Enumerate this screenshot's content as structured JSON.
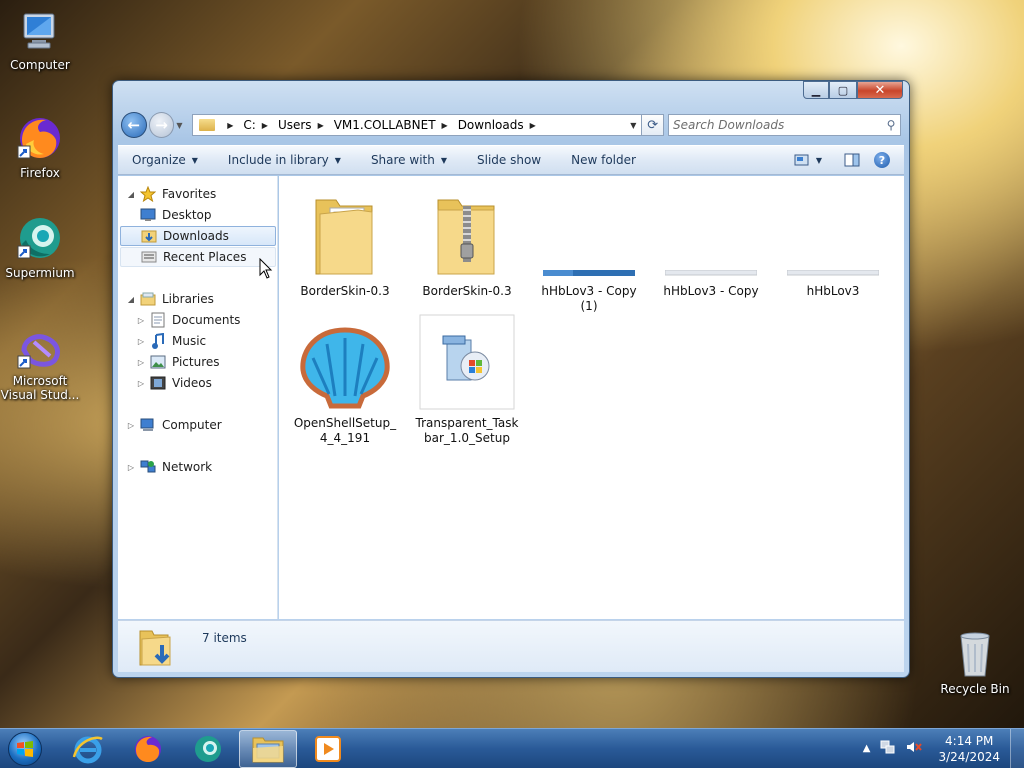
{
  "desktop": {
    "icons": [
      {
        "label": "Computer",
        "icon": "computer-icon"
      },
      {
        "label": "Firefox",
        "icon": "firefox-icon"
      },
      {
        "label": "Supermium",
        "icon": "supermium-icon"
      },
      {
        "label_line1": "Microsoft",
        "label_line2": "Visual Stud...",
        "icon": "visual-studio-icon"
      },
      {
        "label": "Recycle Bin",
        "icon": "recycle-bin-icon"
      }
    ]
  },
  "window": {
    "address": {
      "crumbs": [
        "C:",
        "Users",
        "VM1.COLLABNET",
        "Downloads"
      ]
    },
    "search": {
      "placeholder": "Search Downloads"
    },
    "toolbar": {
      "organize": "Organize",
      "include_in_library": "Include in library",
      "share_with": "Share with",
      "slide_show": "Slide show",
      "new_folder": "New folder"
    },
    "nav": {
      "favorites": "Favorites",
      "desktop": "Desktop",
      "downloads": "Downloads",
      "recent_places": "Recent Places",
      "libraries": "Libraries",
      "documents": "Documents",
      "music": "Music",
      "pictures": "Pictures",
      "videos": "Videos",
      "computer": "Computer",
      "network": "Network"
    },
    "files": [
      {
        "line1": "BorderSkin-0.3",
        "line2": "",
        "icon": "folder-icon"
      },
      {
        "line1": "BorderSkin-0.3",
        "line2": "",
        "icon": "zip-folder-icon"
      },
      {
        "line1": "hHbLov3 - Copy",
        "line2": "(1)",
        "icon": "image-thumbnail-icon"
      },
      {
        "line1": "hHbLov3 - Copy",
        "line2": "",
        "icon": "image-thumbnail-icon"
      },
      {
        "line1": "hHbLov3",
        "line2": "",
        "icon": "image-thumbnail-icon"
      },
      {
        "line1": "OpenShellSetup_",
        "line2": "4_4_191",
        "icon": "openshell-icon"
      },
      {
        "line1": "Transparent_Task",
        "line2": "bar_1.0_Setup",
        "icon": "installer-icon"
      }
    ],
    "details": {
      "count": "7 items"
    }
  },
  "taskbar": {
    "clock_time": "4:14 PM",
    "clock_date": "3/24/2024"
  },
  "colors": {
    "accent": "#1e395b",
    "selection": "#d7e7f9",
    "taskbar": "#2a5a98"
  }
}
